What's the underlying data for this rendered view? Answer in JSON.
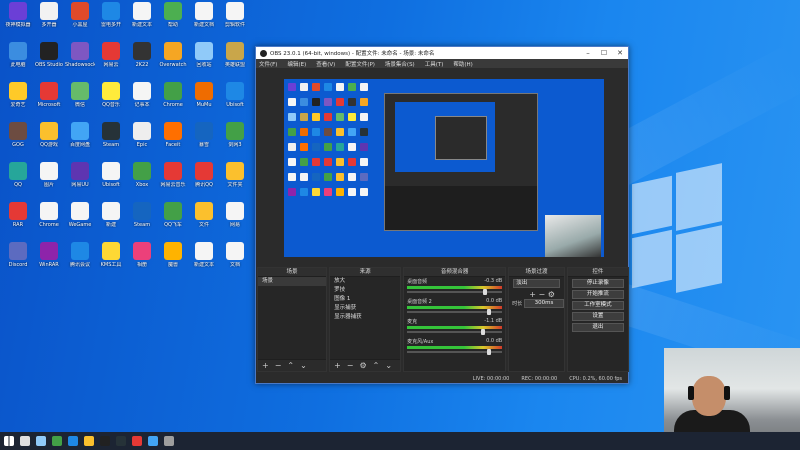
{
  "desktop_icons": [
    {
      "label": "夜神模拟器",
      "color": "#6b3fd6"
    },
    {
      "label": "多开器",
      "color": "#f2f2f2"
    },
    {
      "label": "小黑屋",
      "color": "#e04a2a"
    },
    {
      "label": "雷电多开",
      "color": "#1e88e5"
    },
    {
      "label": "新建文本",
      "color": "#f5f5f5"
    },
    {
      "label": "帮助",
      "color": "#4caf50"
    },
    {
      "label": "新建文档",
      "color": "#f5f5f5"
    },
    {
      "label": "剪辑软件",
      "color": "#f5f5f5"
    },
    {
      "label": "此电脑",
      "color": "#3b8de0"
    },
    {
      "label": "OBS Studio",
      "color": "#222222"
    },
    {
      "label": "Shadowsocks",
      "color": "#7e57c2"
    },
    {
      "label": "网易云",
      "color": "#e53935"
    },
    {
      "label": "2K22",
      "color": "#333333"
    },
    {
      "label": "Overwatch",
      "color": "#f5a623"
    },
    {
      "label": "回收站",
      "color": "#90caf9"
    },
    {
      "label": "英雄联盟",
      "color": "#c9a64a"
    },
    {
      "label": "爱奇艺",
      "color": "#ffca28"
    },
    {
      "label": "Microsoft",
      "color": "#e53935"
    },
    {
      "label": "微信",
      "color": "#66bb6a"
    },
    {
      "label": "QQ音乐",
      "color": "#ffeb3b"
    },
    {
      "label": "记事本",
      "color": "#f5f5f5"
    },
    {
      "label": "Chrome",
      "color": "#43a047"
    },
    {
      "label": "MuMu",
      "color": "#ef6c00"
    },
    {
      "label": "Ubisoft",
      "color": "#1e88e5"
    },
    {
      "label": "GOG",
      "color": "#6d4c41"
    },
    {
      "label": "QQ游戏",
      "color": "#fbc02d"
    },
    {
      "label": "百度网盘",
      "color": "#42a5f5"
    },
    {
      "label": "Steam",
      "color": "#263238"
    },
    {
      "label": "Epic",
      "color": "#eeeeee"
    },
    {
      "label": "Faceit",
      "color": "#ff6f00"
    },
    {
      "label": "暴雪",
      "color": "#1565c0"
    },
    {
      "label": "剑网3",
      "color": "#43a047"
    },
    {
      "label": "QQ",
      "color": "#26a69a"
    },
    {
      "label": "图片",
      "color": "#f5f5f5"
    },
    {
      "label": "网易UU",
      "color": "#5e35b1"
    },
    {
      "label": "Ubisoft",
      "color": "#f5f5f5"
    },
    {
      "label": "Xbox",
      "color": "#43a047"
    },
    {
      "label": "网易云音乐",
      "color": "#e53935"
    },
    {
      "label": "腾讯QQ",
      "color": "#e53935"
    },
    {
      "label": "文件夹",
      "color": "#fbc02d"
    },
    {
      "label": "RAR",
      "color": "#e53935"
    },
    {
      "label": "Chrome",
      "color": "#f5f5f5"
    },
    {
      "label": "WeGame",
      "color": "#f5f5f5"
    },
    {
      "label": "新建",
      "color": "#f5f5f5"
    },
    {
      "label": "Steam",
      "color": "#1565c0"
    },
    {
      "label": "QQ飞车",
      "color": "#43a047"
    },
    {
      "label": "文件",
      "color": "#fbc02d"
    },
    {
      "label": "网易",
      "color": "#f5f5f5"
    },
    {
      "label": "Discord",
      "color": "#5c6bc0"
    },
    {
      "label": "WinRAR",
      "color": "#8e24aa"
    },
    {
      "label": "腾讯会议",
      "color": "#1e88e5"
    },
    {
      "label": "KMS工具",
      "color": "#fdd835"
    },
    {
      "label": "相册",
      "color": "#ec407a"
    },
    {
      "label": "魔兽",
      "color": "#ffb300"
    },
    {
      "label": "新建文本",
      "color": "#f5f5f5"
    },
    {
      "label": "文档",
      "color": "#f5f5f5"
    }
  ],
  "obs": {
    "title": "OBS 23.0.1 (64-bit, windows) - 配置文件: 未命名 - 场景: 未命名",
    "menu": [
      "文件(F)",
      "编辑(E)",
      "查看(V)",
      "配置文件(P)",
      "场景集合(S)",
      "工具(T)",
      "帮助(H)"
    ],
    "panels": {
      "scenes": {
        "title": "场景",
        "items": [
          "场景"
        ]
      },
      "sources": {
        "title": "来源",
        "items": [
          "放大",
          "罗技",
          "图像 1",
          "显示捕获",
          "显示器捕获"
        ]
      },
      "mixer": {
        "title": "音频混合器",
        "tracks": [
          {
            "name": "桌面音频",
            "db": "-0.3 dB"
          },
          {
            "name": "桌面音频 2",
            "db": "0.0 dB"
          },
          {
            "name": "麦克",
            "db": "-1.1 dB"
          },
          {
            "name": "麦克风/Aux",
            "db": "0.0 dB"
          }
        ]
      },
      "transitions": {
        "title": "场景过渡",
        "mode": "淡出",
        "duration_label": "时长",
        "duration": "300ms"
      },
      "controls": {
        "title": "控件",
        "buttons": [
          "停止录像",
          "开始推流",
          "工作室模式",
          "设置",
          "退出"
        ]
      }
    },
    "status": {
      "live": "LIVE: 00:00:00",
      "rec": "REC: 00:00:00",
      "cpu": "CPU: 0.2%, 60.00 fps"
    }
  },
  "taskbar_icons": [
    "start",
    "search",
    "task-view",
    "chrome",
    "edge",
    "explorer",
    "obs",
    "steam",
    "app1",
    "app2",
    "app3"
  ]
}
